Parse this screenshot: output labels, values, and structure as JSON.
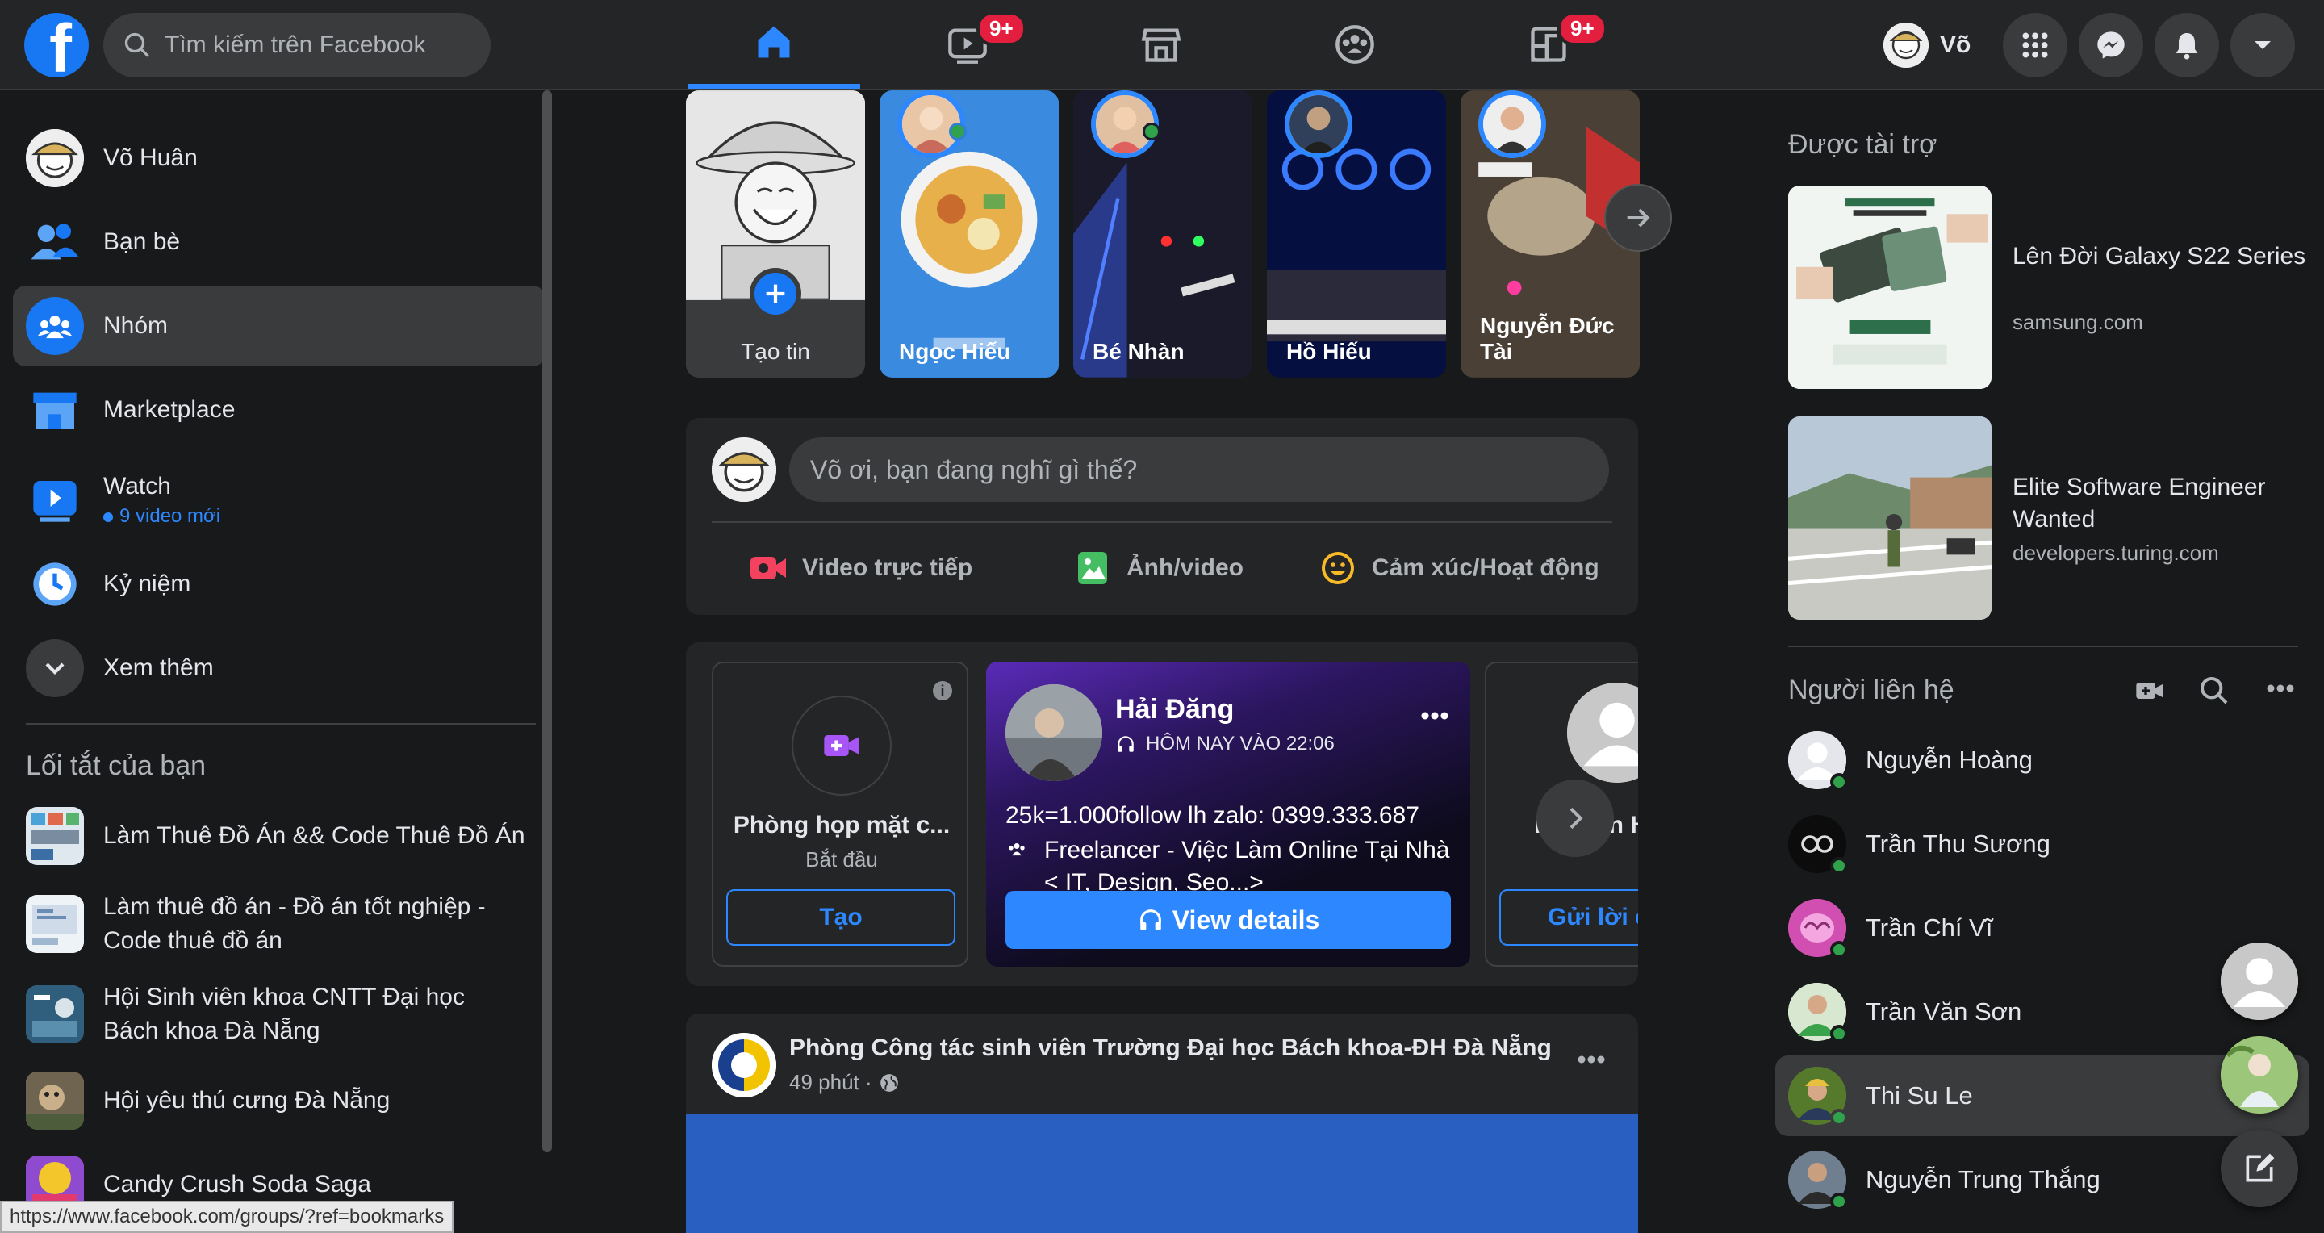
{
  "header": {
    "search_placeholder": "Tìm kiếm trên Facebook",
    "watch_badge": "9+",
    "gaming_badge": "9+",
    "profile_name": "Võ"
  },
  "sidebar": {
    "items": [
      {
        "label": "Võ Huân"
      },
      {
        "label": "Bạn bè"
      },
      {
        "label": "Nhóm"
      },
      {
        "label": "Marketplace"
      },
      {
        "label": "Watch",
        "sub": "9 video mới"
      },
      {
        "label": "Kỷ niệm"
      },
      {
        "label": "Xem thêm"
      }
    ],
    "shortcuts_title": "Lối tắt của bạn",
    "shortcuts": [
      {
        "label": "Làm Thuê Đồ Án && Code Thuê Đồ Án"
      },
      {
        "label": "Làm thuê đồ án - Đồ án tốt nghiệp - Code thuê đồ án"
      },
      {
        "label": "Hội Sinh viên khoa CNTT Đại học Bách khoa Đà Nẵng"
      },
      {
        "label": "Hội yêu thú cưng Đà Nẵng"
      },
      {
        "label": "Candy Crush Soda Saga"
      }
    ]
  },
  "stories": [
    {
      "name": "Tạo tin"
    },
    {
      "name": "Ngọc Hiếu"
    },
    {
      "name": "Bé Nhàn"
    },
    {
      "name": "Hồ Hiếu"
    },
    {
      "name": "Nguyễn Đức Tài"
    }
  ],
  "composer": {
    "placeholder": "Võ ơi, bạn đang nghĩ gì thế?",
    "actions": [
      "Video trực tiếp",
      "Ảnh/video",
      "Cảm xúc/Hoạt động"
    ]
  },
  "rooms": {
    "create_title": "Phòng họp mặt c...",
    "create_sub": "Bắt đầu",
    "create_button": "Tạo",
    "ad_name": "Hải Đăng",
    "ad_time": "HÔM NAY VÀO 22:06",
    "ad_line1": "25k=1.000follow lh zalo: 0399.333.687",
    "ad_line2": "Freelancer - Việc Làm Online Tại Nhà < IT, Design, Seo...>",
    "ad_button": "View details",
    "third_name": "Nguyễn H",
    "third_button": "Gửi lời c"
  },
  "post": {
    "author": "Phòng Công tác sinh viên Trường Đại học Bách khoa-ĐH Đà Nẵng",
    "time": "49 phút ·"
  },
  "sponsored": {
    "title": "Được tài trợ",
    "ads": [
      {
        "title": "Lên Đời Galaxy S22 Series",
        "url": "samsung.com"
      },
      {
        "title": "Elite Software Engineer Wanted",
        "url": "developers.turing.com"
      }
    ]
  },
  "contacts": {
    "title": "Người liên hệ",
    "list": [
      {
        "name": "Nguyễn Hoàng"
      },
      {
        "name": "Trần Thu Sương"
      },
      {
        "name": "Trần Chí Vĩ"
      },
      {
        "name": "Trần Văn Sơn"
      },
      {
        "name": "Thi Su Le"
      },
      {
        "name": "Nguyễn Trung Thắng"
      }
    ]
  },
  "status_bar": {
    "url": "https://www.facebook.com/groups/?ref=bookmarks"
  },
  "colors": {
    "accent": "#2d88ff",
    "background": "#18191a",
    "surface": "#242526",
    "online": "#31a24c",
    "badge": "#e41e3f"
  }
}
